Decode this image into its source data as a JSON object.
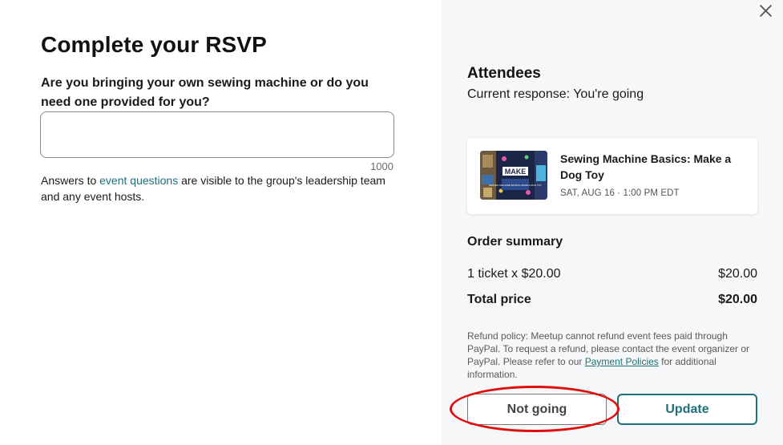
{
  "form": {
    "title": "Complete your RSVP",
    "question": "Are you bringing your own sewing machine or do you need one provided for you?",
    "answer_value": "",
    "char_count": "1000",
    "disclaimer_prefix": "Answers to ",
    "disclaimer_link": "event questions",
    "disclaimer_suffix": " are visible to the group's leadership team and any event hosts."
  },
  "panel": {
    "close_icon": "close-icon",
    "attendees_title": "Attendees",
    "current_response": "Current response: You're going",
    "event": {
      "title": "Sewing Machine Basics: Make a Dog Toy",
      "date": "SAT, AUG 16 · 1:00 PM EDT",
      "thumb_text_main": "MAKE",
      "thumb_text_sub": "SEWING MACHINE BASICS: MAKE A DOG TOY"
    },
    "order_summary_title": "Order summary",
    "ticket_line_label": "1 ticket x $20.00",
    "ticket_line_amount": "$20.00",
    "total_label": "Total price",
    "total_amount": "$20.00",
    "refund_prefix": "Refund policy: Meetup cannot refund event fees paid through PayPal. To request a refund, please contact the event organizer or PayPal. Please refer to our ",
    "refund_link": "Payment Policies",
    "refund_suffix": " for additional information.",
    "not_going_label": "Not going",
    "update_label": "Update"
  },
  "colors": {
    "accent": "#1f6f7a",
    "highlight": "#e00d0d",
    "panel_bg": "#f6f7f8"
  }
}
